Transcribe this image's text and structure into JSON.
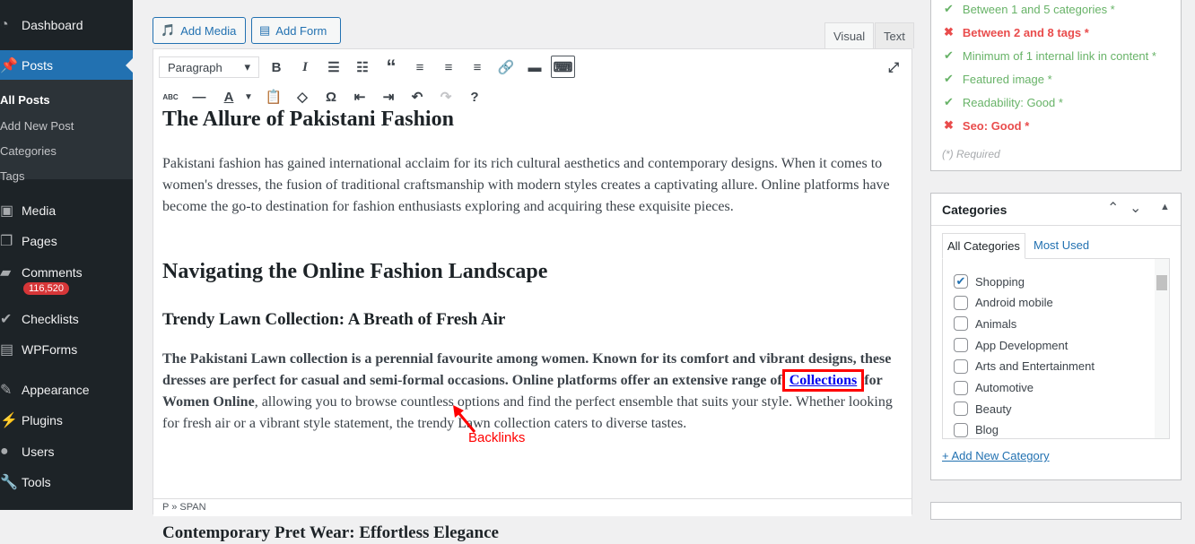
{
  "sidebar": {
    "items": [
      {
        "label": "Dashboard",
        "icon": "dashboard-icon"
      },
      {
        "label": "Posts",
        "icon": "pin-icon"
      },
      {
        "label": "Media",
        "icon": "media-icon"
      },
      {
        "label": "Pages",
        "icon": "pages-icon"
      },
      {
        "label": "Comments",
        "icon": "comments-icon"
      },
      {
        "label": "Checklists",
        "icon": "checklist-icon"
      },
      {
        "label": "WPForms",
        "icon": "wpforms-icon"
      },
      {
        "label": "Appearance",
        "icon": "brush-icon"
      },
      {
        "label": "Plugins",
        "icon": "plugin-icon"
      },
      {
        "label": "Users",
        "icon": "user-icon"
      },
      {
        "label": "Tools",
        "icon": "wrench-icon"
      }
    ],
    "submenu": [
      "All Posts",
      "Add New Post",
      "Categories",
      "Tags"
    ],
    "comments_badge": "116,520"
  },
  "editor": {
    "add_media": "Add Media",
    "add_form": "Add Form",
    "tab_visual": "Visual",
    "tab_text": "Text",
    "format": "Paragraph",
    "status_path": "P » SPAN",
    "content": {
      "h1": "The Allure of Pakistani Fashion",
      "p1": "Pakistani fashion has gained international acclaim for its rich cultural aesthetics and contemporary designs. When it comes to women's dresses, the fusion of traditional craftsmanship with modern styles creates a captivating allure. Online platforms have become the go-to destination for fashion enthusiasts exploring and acquiring these exquisite pieces.",
      "h2": "Navigating the Online Fashion Landscape",
      "h3a": "Trendy Lawn Collection: A Breath of Fresh Air",
      "p2_bold": "The Pakistani Lawn collection is a perennial favourite among women. Known for its comfort and vibrant designs, these dresses are perfect for casual and semi-formal occasions. Online platforms offer an extensive range of ",
      "p2_link": "Collections",
      "p2_bold2": " for Women Online",
      "p2_rest": ", allowing you to browse countless options and find the perfect ensemble that suits your style. Whether looking for fresh air or a vibrant style statement, the trendy Lawn collection caters to diverse tastes.",
      "annotation": "Backlinks",
      "h3b": "Contemporary Pret Wear: Effortless Elegance"
    }
  },
  "checklist": {
    "items": [
      {
        "label": "Between 1 and 5 categories *",
        "status": "pass"
      },
      {
        "label": "Between 2 and 8 tags *",
        "status": "fail"
      },
      {
        "label": "Minimum of 1 internal link in content *",
        "status": "pass"
      },
      {
        "label": "Featured image *",
        "status": "pass"
      },
      {
        "label": "Readability: Good *",
        "status": "pass"
      },
      {
        "label": "Seo: Good *",
        "status": "fail"
      }
    ],
    "required_note": "(*) Required"
  },
  "categories": {
    "title": "Categories",
    "tab_all": "All Categories",
    "tab_most": "Most Used",
    "items": [
      {
        "label": "Shopping",
        "checked": true
      },
      {
        "label": "Android mobile",
        "checked": false
      },
      {
        "label": "Animals",
        "checked": false
      },
      {
        "label": "App Development",
        "checked": false
      },
      {
        "label": "Arts and Entertainment",
        "checked": false
      },
      {
        "label": "Automotive",
        "checked": false
      },
      {
        "label": "Beauty",
        "checked": false
      },
      {
        "label": "Blog",
        "checked": false
      }
    ],
    "add_new": "+ Add New Category"
  },
  "colors": {
    "accent": "#2271b1",
    "pass": "#68b368",
    "fail": "#e94c4c",
    "sidebar": "#1d2327"
  }
}
